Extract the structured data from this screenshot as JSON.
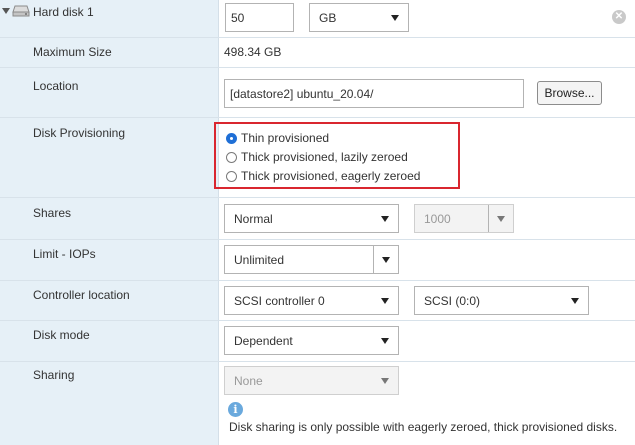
{
  "hard_disk": {
    "title": "Hard disk 1",
    "size_value": "50",
    "size_unit": "GB",
    "remove_icon": "close-icon"
  },
  "max_size": {
    "label": "Maximum Size",
    "value": "498.34 GB"
  },
  "location": {
    "label": "Location",
    "value": "[datastore2] ubuntu_20.04/",
    "browse_label": "Browse..."
  },
  "provisioning": {
    "label": "Disk Provisioning",
    "options": [
      {
        "label": "Thin provisioned",
        "selected": true
      },
      {
        "label": "Thick provisioned, lazily zeroed",
        "selected": false
      },
      {
        "label": "Thick provisioned, eagerly zeroed",
        "selected": false
      }
    ],
    "highlight_color": "#d9262f"
  },
  "shares": {
    "label": "Shares",
    "value": "Normal",
    "amount": "1000"
  },
  "limit": {
    "label": "Limit - IOPs",
    "value": "Unlimited"
  },
  "controller": {
    "label": "Controller location",
    "controller": "SCSI controller 0",
    "node": "SCSI (0:0)"
  },
  "disk_mode": {
    "label": "Disk mode",
    "value": "Dependent"
  },
  "sharing": {
    "label": "Sharing",
    "value": "None",
    "info_text": "Disk sharing is only possible with eagerly zeroed, thick provisioned disks."
  },
  "colors": {
    "label_column_bg": "#e6f0f7",
    "radio_selected": "#1f6fd6",
    "info_icon": "#6aa9dd"
  }
}
